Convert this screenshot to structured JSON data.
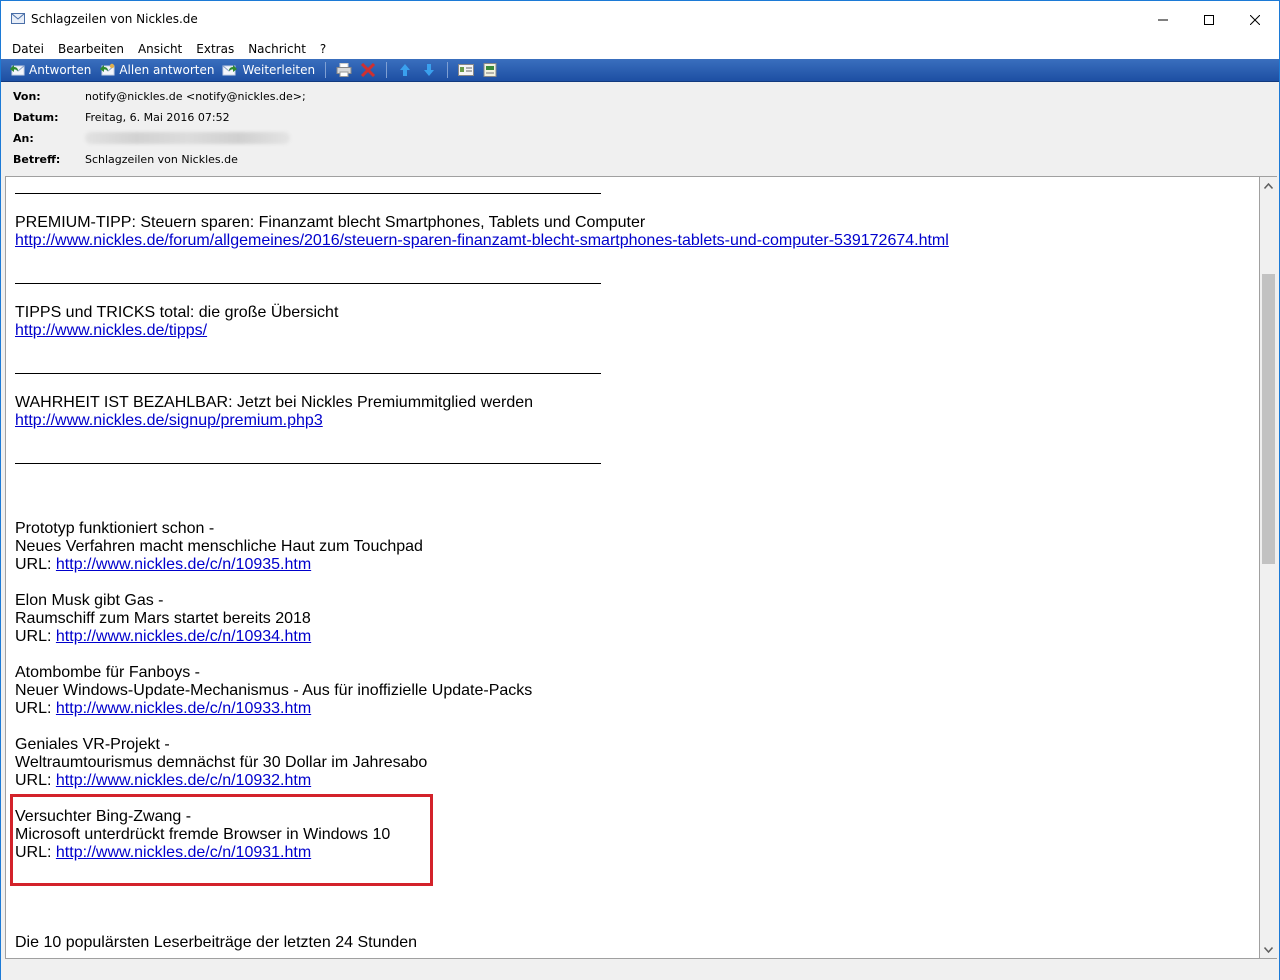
{
  "window": {
    "title": "Schlagzeilen von Nickles.de",
    "icon": "envelope-icon"
  },
  "menu": {
    "items": [
      "Datei",
      "Bearbeiten",
      "Ansicht",
      "Extras",
      "Nachricht",
      "?"
    ]
  },
  "toolbar": {
    "reply": "Antworten",
    "reply_all": "Allen antworten",
    "forward": "Weiterleiten",
    "icons": [
      "print-icon",
      "delete-icon",
      "up-arrow-icon",
      "down-arrow-icon",
      "contact-card-icon",
      "addressbook-icon"
    ]
  },
  "header": {
    "from_label": "Von:",
    "from_value": "notify@nickles.de <notify@nickles.de>;",
    "date_label": "Datum:",
    "date_value": "Freitag, 6. Mai 2016 07:52",
    "to_label": "An:",
    "subject_label": "Betreff:",
    "subject_value": "Schlagzeilen von Nickles.de"
  },
  "body": {
    "premium_tip": "PREMIUM-TIPP: Steuern sparen: Finanzamt blecht Smartphones, Tablets und Computer",
    "premium_tip_url": "http://www.nickles.de/forum/allgemeines/2016/steuern-sparen-finanzamt-blecht-smartphones-tablets-und-computer-539172674.html",
    "tipps": "TIPPS und TRICKS total: die große Übersicht",
    "tipps_url": "http://www.nickles.de/tipps/",
    "wahrheit": "WAHRHEIT IST BEZAHLBAR: Jetzt bei Nickles Premiummitglied werden",
    "wahrheit_url": "http://www.nickles.de/signup/premium.php3",
    "url_prefix": "URL: ",
    "news": [
      {
        "title": "Prototyp funktioniert schon -",
        "subtitle": "Neues Verfahren macht menschliche Haut zum Touchpad",
        "url": "http://www.nickles.de/c/n/10935.htm"
      },
      {
        "title": "Elon Musk gibt Gas -",
        "subtitle": "Raumschiff zum Mars startet bereits 2018",
        "url": "http://www.nickles.de/c/n/10934.htm"
      },
      {
        "title": "Atombombe für Fanboys -",
        "subtitle": "Neuer Windows-Update-Mechanismus - Aus für inoffizielle Update-Packs",
        "url": "http://www.nickles.de/c/n/10933.htm"
      },
      {
        "title": "Geniales VR-Projekt -",
        "subtitle": "Weltraumtourismus demnächst für 30 Dollar im Jahresabo",
        "url": "http://www.nickles.de/c/n/10932.htm"
      },
      {
        "title": "Versuchter Bing-Zwang -",
        "subtitle": "Microsoft unterdrückt fremde Browser in Windows 10",
        "url": "http://www.nickles.de/c/n/10931.htm"
      }
    ],
    "popular": "Die 10 populärsten Leserbeiträge der letzten 24 Stunden"
  },
  "colors": {
    "highlight": "#d3222a",
    "link": "#0000cc",
    "toolbar": "#1d4fa3"
  }
}
